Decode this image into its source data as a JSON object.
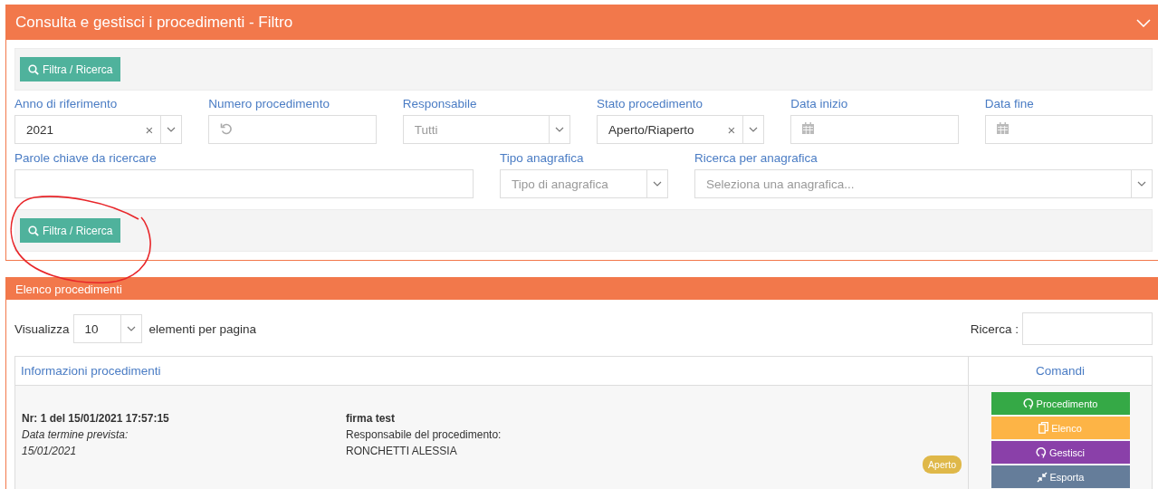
{
  "filter_panel": {
    "title": "Consulta e gestisci i procedimenti - Filtro",
    "search_button": "Filtra / Ricerca",
    "fields": [
      {
        "kind": "select",
        "label": "Anno di riferimento",
        "value": "2021",
        "clear": "×"
      },
      {
        "kind": "number",
        "label": "Numero procedimento"
      },
      {
        "kind": "select",
        "label": "Responsabile",
        "placeholder": "Tutti"
      },
      {
        "kind": "select",
        "label": "Stato procedimento",
        "value": "Aperto/Riaperto",
        "clear": "×"
      },
      {
        "kind": "date",
        "label": "Data inizio"
      },
      {
        "kind": "date",
        "label": "Data fine"
      },
      {
        "kind": "text",
        "label": "Parole chiave da ricercare"
      },
      {
        "kind": "select",
        "label": "Tipo anagrafica",
        "placeholder": "Tipo di anagrafica"
      },
      {
        "kind": "select",
        "label": "Ricerca per anagrafica",
        "placeholder": "Seleziona una anagrafica..."
      }
    ],
    "bottom_button": "Filtra / Ricerca"
  },
  "list_panel": {
    "title": "Elenco procedimenti",
    "show_label": "Visualizza",
    "page_size": "10",
    "per_page_label": "elementi per pagina",
    "search_label": "Ricerca :",
    "columns": [
      "Informazioni procedimenti",
      "Comandi"
    ],
    "rows": [
      {
        "number_line": "Nr: 1 del 15/01/2021 17:57:15",
        "due_label": "Data termine prevista:",
        "due_date": "15/01/2021",
        "subject": "firma test",
        "responsible_label": "Responsabile del procedimento:",
        "responsible": "RONCHETTI ALESSIA",
        "status": "Aperto",
        "commands": [
          {
            "label": "Procedimento",
            "kind": "refresh",
            "color": "#35a946"
          },
          {
            "label": "Elenco",
            "kind": "copy",
            "color": "#fdb446"
          },
          {
            "label": "Gestisci",
            "kind": "refresh",
            "color": "#8a40a9"
          },
          {
            "label": "Esporta",
            "kind": "compress",
            "color": "#657d9a"
          }
        ]
      }
    ]
  }
}
